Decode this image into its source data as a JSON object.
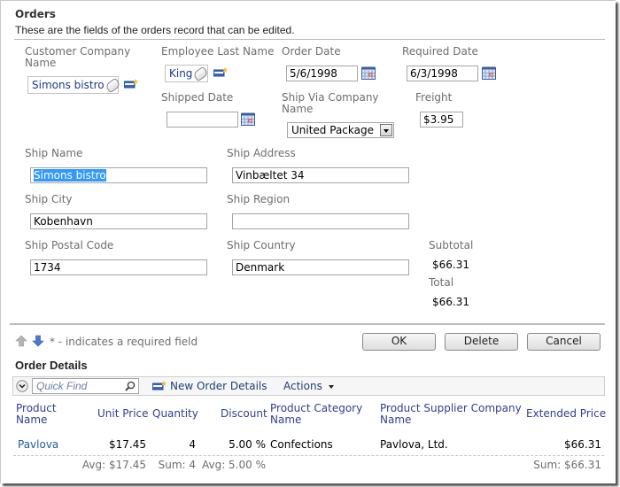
{
  "form": {
    "title": "Orders",
    "description": "These are the fields of the orders record that can be edited."
  },
  "fields": {
    "customer_company_name": {
      "label_line1": "Customer Company",
      "label_line2": "Name",
      "value": "Simons bistro"
    },
    "employee_last_name": {
      "label": "Employee Last Name",
      "value": "King"
    },
    "order_date": {
      "label": "Order Date",
      "value": "5/6/1998"
    },
    "required_date": {
      "label": "Required Date",
      "value": "6/3/1998"
    },
    "shipped_date": {
      "label": "Shipped Date",
      "value": ""
    },
    "ship_via_company_name": {
      "label_line1": "Ship Via Company",
      "label_line2": "Name",
      "value": "United Package"
    },
    "freight": {
      "label": "Freight",
      "value": "$3.95"
    },
    "ship_name": {
      "label": "Ship Name",
      "value": "Simons bistro"
    },
    "ship_address": {
      "label": "Ship Address",
      "value": "Vinbæltet 34"
    },
    "ship_city": {
      "label": "Ship City",
      "value": "Kobenhavn"
    },
    "ship_region": {
      "label": "Ship Region",
      "value": ""
    },
    "ship_postal_code": {
      "label": "Ship Postal Code",
      "value": "1734"
    },
    "ship_country": {
      "label": "Ship Country",
      "value": "Denmark"
    },
    "subtotal": {
      "label": "Subtotal",
      "value": "$66.31"
    },
    "total": {
      "label": "Total",
      "value": "$66.31"
    }
  },
  "footer": {
    "required_note": "* - indicates a required field",
    "buttons": {
      "ok": "OK",
      "delete": "Delete",
      "cancel": "Cancel"
    }
  },
  "order_details": {
    "title": "Order Details",
    "toolbar": {
      "quick_find_placeholder": "Quick Find",
      "new_label": "New Order Details",
      "actions_label": "Actions"
    },
    "columns": [
      {
        "line1": "Product",
        "line2": "Name"
      },
      {
        "line1": "Unit Price",
        "line2": ""
      },
      {
        "line1": "Quantity",
        "line2": ""
      },
      {
        "line1": "Discount",
        "line2": ""
      },
      {
        "line1": "Product Category",
        "line2": "Name"
      },
      {
        "line1": "Product Supplier Company",
        "line2": "Name"
      },
      {
        "line1": "Extended Price",
        "line2": ""
      }
    ],
    "rows": [
      {
        "product_name": "Pavlova",
        "unit_price": "$17.45",
        "quantity": "4",
        "discount": "5.00 %",
        "category": "Confections",
        "supplier": "Pavlova, Ltd.",
        "extended_price": "$66.31"
      }
    ],
    "aggregates": {
      "unit_price": "Avg: $17.45",
      "quantity": "Sum: 4",
      "discount": "Avg: 5.00 %",
      "extended_price": "Sum: $66.31"
    }
  }
}
